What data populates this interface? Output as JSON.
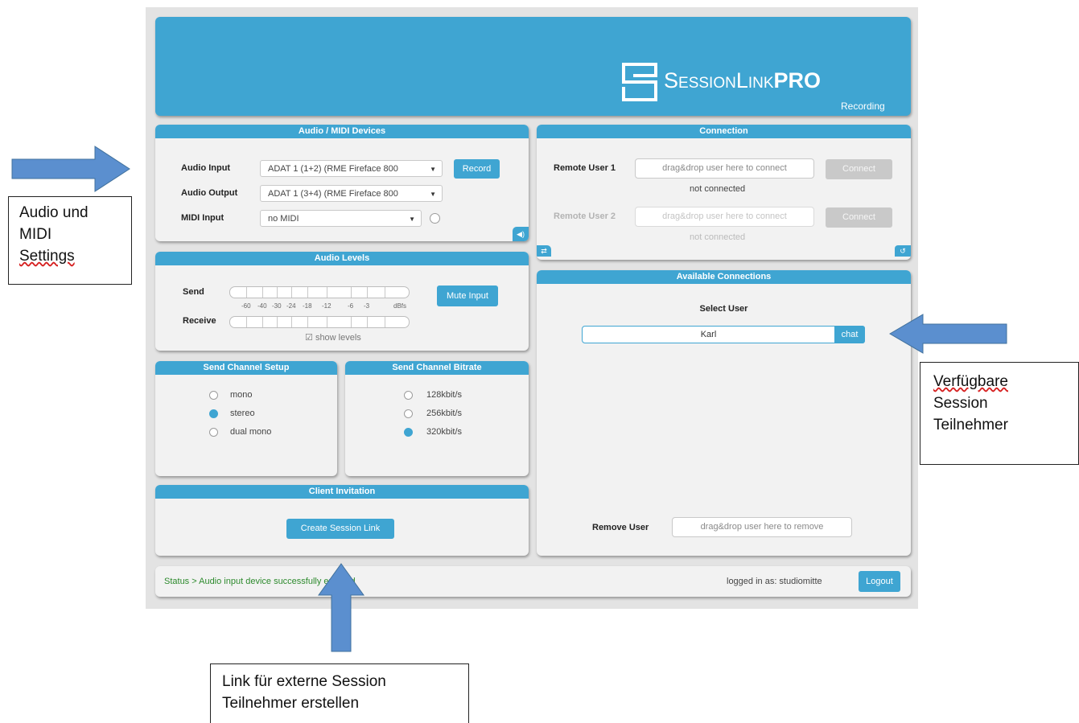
{
  "logo": {
    "brand": "SessionLinkPRO",
    "sub": "Recording"
  },
  "devices": {
    "title": "Audio / MIDI Devices",
    "audio_input_label": "Audio Input",
    "audio_input_value": "ADAT 1 (1+2) (RME Fireface 800",
    "audio_output_label": "Audio Output",
    "audio_output_value": "ADAT 1 (3+4) (RME Fireface 800",
    "midi_input_label": "MIDI Input",
    "midi_input_value": "no MIDI",
    "record_label": "Record"
  },
  "levels": {
    "title": "Audio Levels",
    "send_label": "Send",
    "receive_label": "Receive",
    "scale": [
      "-60",
      "-40",
      "-30",
      "-24",
      "-18",
      "-12",
      "-6",
      "-3",
      "dBfs"
    ],
    "mute_label": "Mute Input",
    "show_levels_label": "show levels",
    "show_levels_checked": true
  },
  "channel_setup": {
    "title": "Send Channel Setup",
    "options": [
      "mono",
      "stereo",
      "dual mono"
    ],
    "selected": "stereo"
  },
  "bitrate": {
    "title": "Send Channel Bitrate",
    "options": [
      "128kbit/s",
      "256kbit/s",
      "320kbit/s"
    ],
    "selected": "320kbit/s"
  },
  "invite": {
    "title": "Client Invitation",
    "button": "Create Session Link"
  },
  "connection": {
    "title": "Connection",
    "remote1_label": "Remote User 1",
    "remote1_placeholder": "drag&drop user here to connect",
    "remote1_status": "not connected",
    "remote2_label": "Remote User 2",
    "remote2_placeholder": "drag&drop user here to connect",
    "remote2_status": "not connected",
    "connect_label": "Connect"
  },
  "available": {
    "title": "Available Connections",
    "select_user_label": "Select User",
    "users": [
      {
        "name": "Karl",
        "chat": "chat"
      }
    ],
    "remove_label": "Remove User",
    "remove_placeholder": "drag&drop user here to remove"
  },
  "statusbar": {
    "status_text": "Status > Audio input device successfully enabled",
    "logged_in": "logged in as: studiomitte",
    "logout": "Logout"
  },
  "annotations": {
    "audio_midi": [
      "Audio und",
      "MIDI",
      "Settings"
    ],
    "available": [
      "Verfügbare",
      "Session",
      "Teilnehmer"
    ],
    "link": [
      "Link für externe Session",
      "Teilnehmer erstellen"
    ]
  },
  "colors": {
    "accent": "#3fa5d2",
    "arrow": "#5b8fcf",
    "status_green": "#2d8a2d"
  }
}
